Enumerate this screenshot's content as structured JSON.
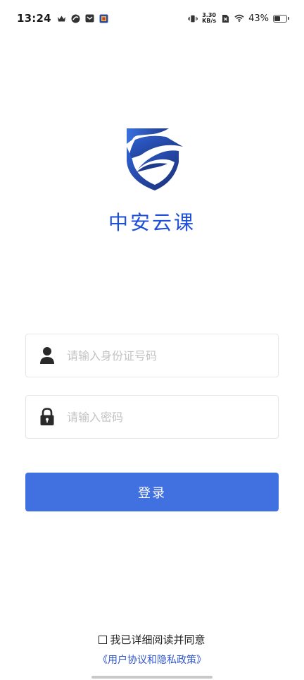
{
  "status_bar": {
    "time": "13:24",
    "net_speed_value": "3.30",
    "net_speed_unit": "KB/s",
    "battery_percent": "43%",
    "battery_level": 0.43,
    "icons": [
      "crown-icon",
      "swirl-app-icon",
      "mail-icon",
      "app-icon",
      "vibrate-icon",
      "no-sim-icon",
      "wifi-icon",
      "battery-icon"
    ]
  },
  "brand": {
    "app_name": "中安云课",
    "logo_primary_color": "#1e3a8a",
    "logo_secondary_color": "#2f62d6"
  },
  "form": {
    "id_placeholder": "请输入身份证号码",
    "password_placeholder": "请输入密码",
    "login_label": "登录"
  },
  "agreement": {
    "text": "我已详细阅读并同意",
    "link": "《用户协议和隐私政策》"
  },
  "colors": {
    "accent": "#4170e0",
    "brand_text": "#1d4fd8",
    "link": "#2f56c9",
    "placeholder": "#c3c3c3"
  }
}
